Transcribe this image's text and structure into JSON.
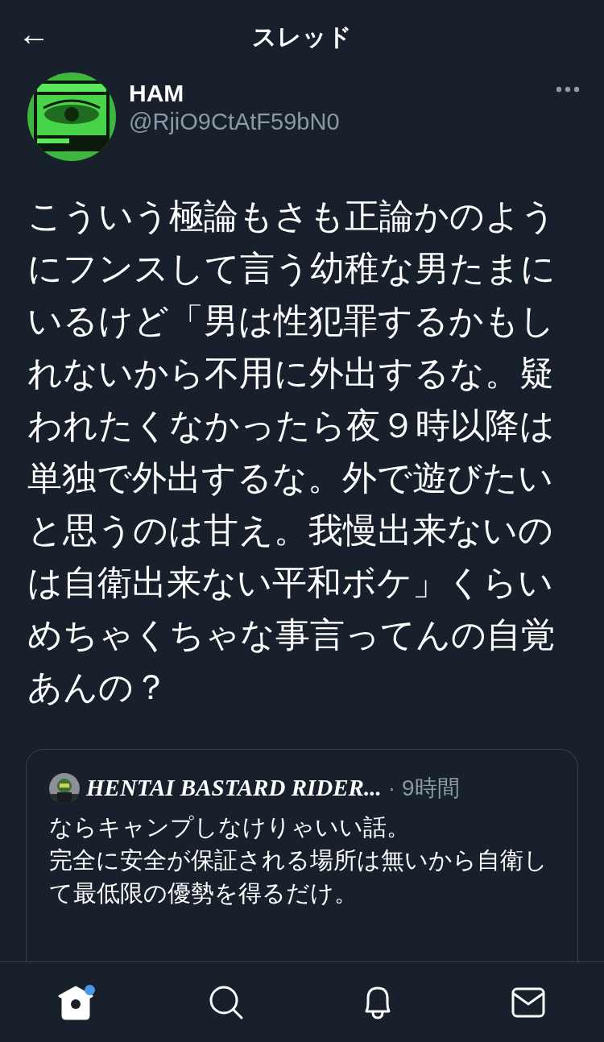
{
  "header": {
    "back": "←",
    "title": "スレッド"
  },
  "tweet": {
    "name": "HAM",
    "handle": "@RjiO9CtAtF59bN0",
    "text": "こういう極論もさも正論かのようにフンスして言う幼稚な男たまにいるけど「男は性犯罪するかもしれないから不用に外出するな。疑われたくなかったら夜９時以降は単独で外出するな。外で遊びたいと思うのは甘え。我慢出来ないのは自衛出来ない平和ボケ」くらいめちゃくちゃな事言ってんの自覚あんの？",
    "quote": {
      "name": "HENTAI BASTARD RIDER...",
      "separator": "·",
      "time": "9時間",
      "paragraphs": [
        [
          "ならキャンプしなけりゃいい話。",
          "完全に安全が保証される場所は無いから自衛して最低限の優勢を得るだけ。"
        ]
      ]
    }
  },
  "tabbar": [
    {
      "kind": "home",
      "selected": true,
      "badge": true
    },
    {
      "kind": "search",
      "selected": false,
      "badge": false
    },
    {
      "kind": "notifications",
      "selected": false,
      "badge": false
    },
    {
      "kind": "messages",
      "selected": false,
      "badge": false
    }
  ]
}
